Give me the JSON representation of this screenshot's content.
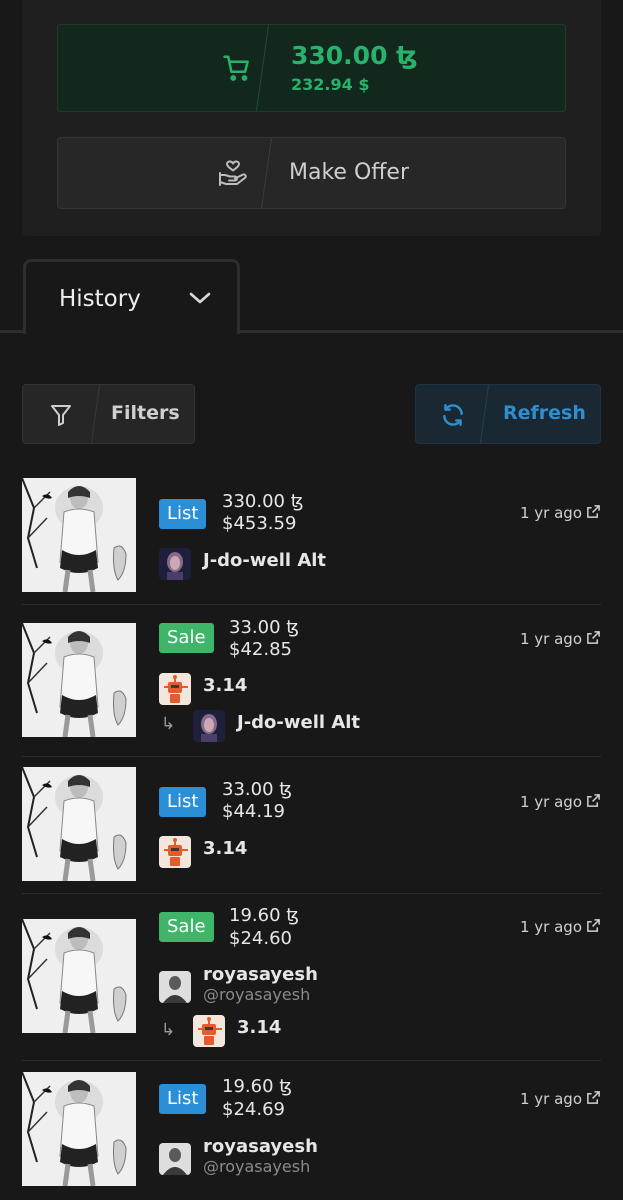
{
  "buy": {
    "price_tz": "330.00 ꜩ",
    "price_usd": "232.94 $"
  },
  "offer": {
    "label": "Make Offer"
  },
  "history_tab": {
    "label": "History"
  },
  "toolbar": {
    "filters_label": "Filters",
    "refresh_label": "Refresh"
  },
  "colors": {
    "accent_green": "#28b26b",
    "accent_blue": "#2d8fd0",
    "list_badge": "#2a8fd6",
    "sale_badge": "#3fb56a"
  },
  "history": [
    {
      "type": "List",
      "tz": "330.00 ꜩ",
      "usd": "$453.59",
      "time": "1 yr ago",
      "user": {
        "name": "J-do-well Alt",
        "avatar": "portrait-avatar"
      }
    },
    {
      "type": "Sale",
      "tz": "33.00 ꜩ",
      "usd": "$42.85",
      "time": "1 yr ago",
      "user": {
        "name": "3.14",
        "avatar": "robot-avatar"
      },
      "to": {
        "name": "J-do-well Alt",
        "avatar": "portrait-avatar"
      }
    },
    {
      "type": "List",
      "tz": "33.00 ꜩ",
      "usd": "$44.19",
      "time": "1 yr ago",
      "user": {
        "name": "3.14",
        "avatar": "robot-avatar"
      }
    },
    {
      "type": "Sale",
      "tz": "19.60 ꜩ",
      "usd": "$24.60",
      "time": "1 yr ago",
      "user": {
        "name": "royasayesh",
        "handle": "@royasayesh",
        "avatar": "photo-avatar"
      },
      "to": {
        "name": "3.14",
        "avatar": "robot-avatar"
      }
    },
    {
      "type": "List",
      "tz": "19.60 ꜩ",
      "usd": "$24.69",
      "time": "1 yr ago",
      "user": {
        "name": "royasayesh",
        "handle": "@royasayesh",
        "avatar": "photo-avatar"
      }
    }
  ]
}
